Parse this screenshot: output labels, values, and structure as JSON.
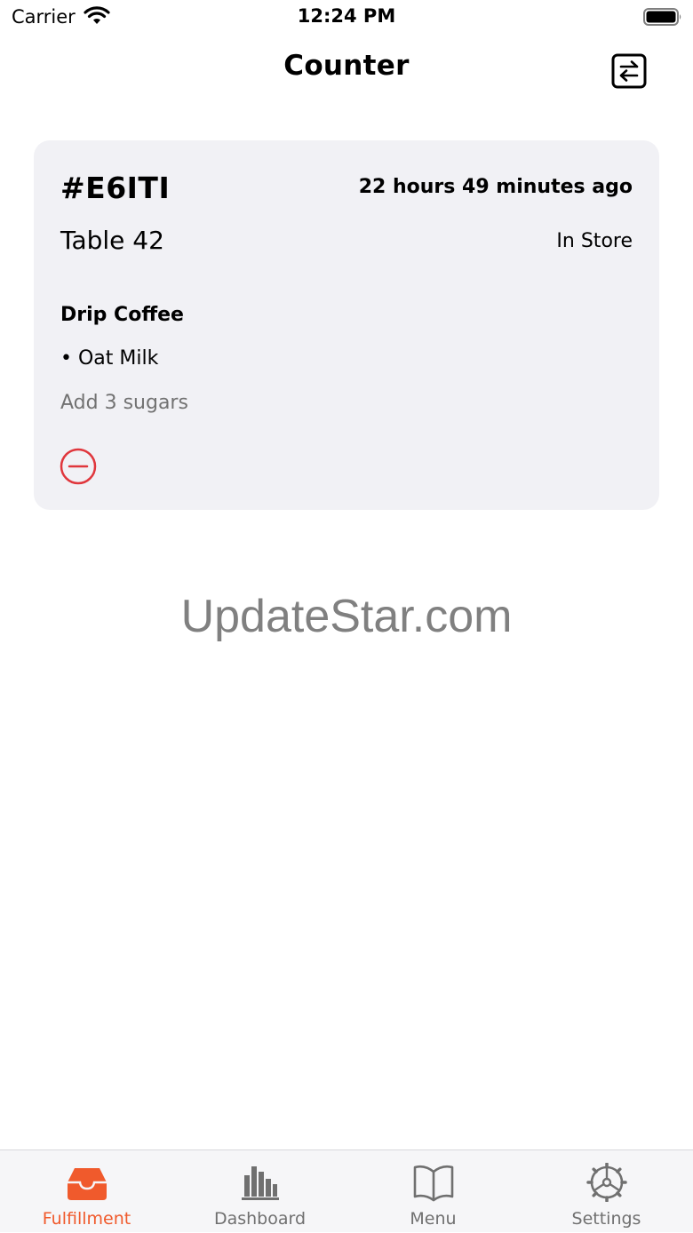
{
  "status_bar": {
    "carrier": "Carrier",
    "time": "12:24 PM",
    "icons": [
      "wifi-icon",
      "battery-icon"
    ]
  },
  "nav": {
    "title": "Counter",
    "action_icon": "swap-arrows-icon"
  },
  "order": {
    "id": "#E6ITI",
    "time_ago": "22 hours 49 minutes ago",
    "table": "Table 42",
    "type": "In Store",
    "item_name": "Drip Coffee",
    "modifier": "• Oat Milk",
    "note": "Add 3 sugars",
    "remove_icon": "minus-circle-icon"
  },
  "watermark": "UpdateStar.com",
  "tabs": [
    {
      "label": "Fulfillment",
      "icon": "inbox-tray-icon",
      "active": true
    },
    {
      "label": "Dashboard",
      "icon": "bar-chart-icon",
      "active": false
    },
    {
      "label": "Menu",
      "icon": "book-icon",
      "active": false
    },
    {
      "label": "Settings",
      "icon": "gear-icon",
      "active": false
    }
  ],
  "colors": {
    "accent": "#f05a2c",
    "remove": "#e0363c",
    "card_bg": "#f1f1f5",
    "inactive_tab": "#707070",
    "note_text": "#727272"
  }
}
